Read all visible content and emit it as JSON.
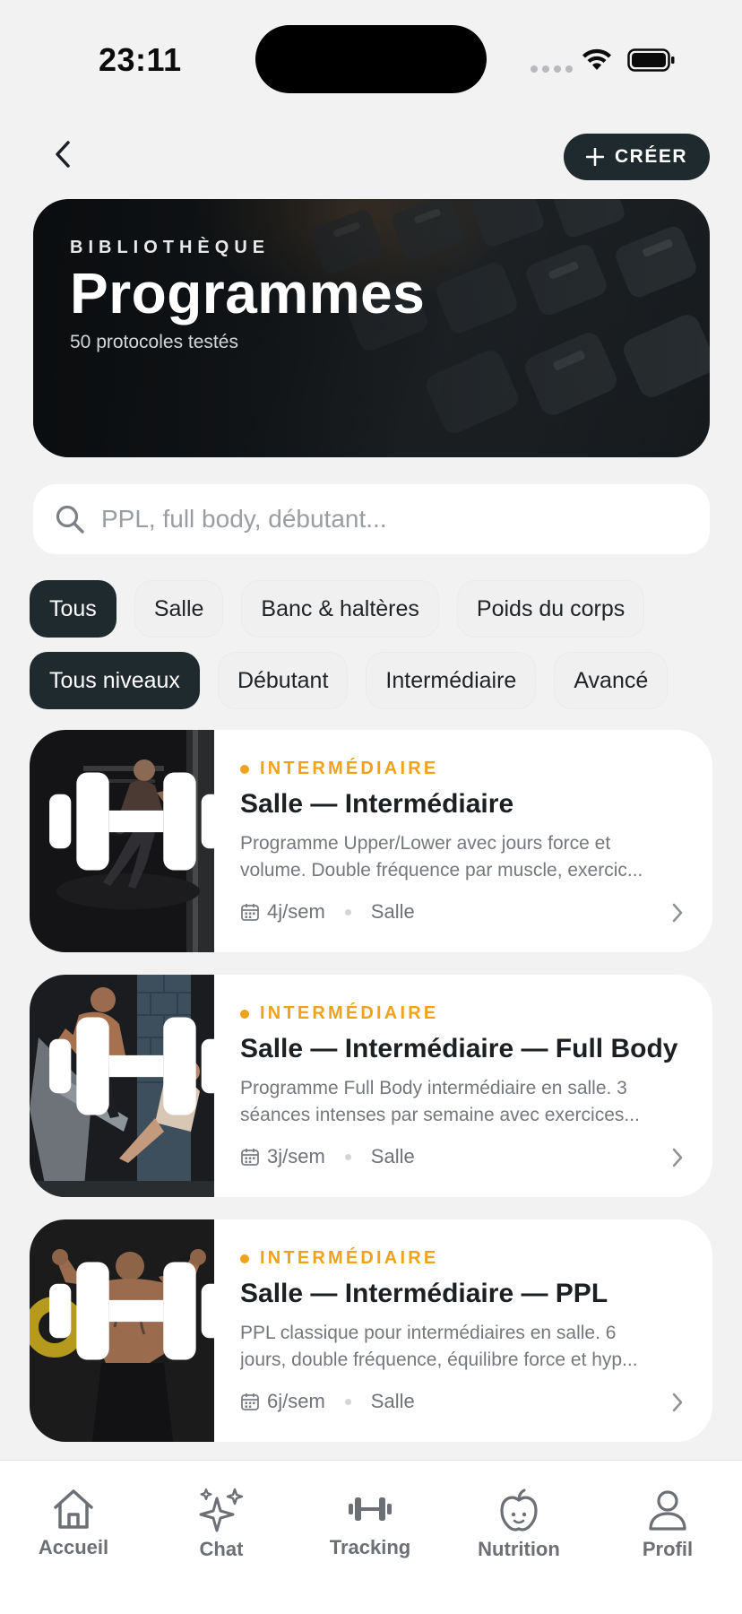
{
  "status_bar": {
    "time": "23:11"
  },
  "header": {
    "create_label": "CRÉER"
  },
  "hero": {
    "eyebrow": "BIBLIOTHÈQUE",
    "title": "Programmes",
    "subtitle": "50 protocoles testés"
  },
  "search": {
    "placeholder": "PPL, full body, débutant..."
  },
  "filters": {
    "equipment": [
      {
        "label": "Tous",
        "active": true
      },
      {
        "label": "Salle",
        "active": false
      },
      {
        "label": "Banc & haltères",
        "active": false
      },
      {
        "label": "Poids du corps",
        "active": false
      }
    ],
    "levels": [
      {
        "label": "Tous niveaux",
        "active": true
      },
      {
        "label": "Débutant",
        "active": false
      },
      {
        "label": "Intermédiaire",
        "active": false
      },
      {
        "label": "Avancé",
        "active": false
      }
    ]
  },
  "programs": [
    {
      "level": "INTERMÉDIAIRE",
      "title": "Salle — Intermédiaire",
      "desc_line1": "Programme Upper/Lower avec jours force et",
      "desc_line2": "volume. Double fréquence par muscle, exercic...",
      "frequency": "4j/sem",
      "location": "Salle"
    },
    {
      "level": "INTERMÉDIAIRE",
      "title": "Salle — Intermédiaire — Full Body",
      "desc_line1": "Programme Full Body intermédiaire en salle. 3",
      "desc_line2": "séances intenses par semaine avec exercices...",
      "frequency": "3j/sem",
      "location": "Salle"
    },
    {
      "level": "INTERMÉDIAIRE",
      "title": "Salle — Intermédiaire — PPL",
      "desc_line1": "PPL classique pour intermédiaires en salle. 6",
      "desc_line2": "jours, double fréquence, équilibre force et hyp...",
      "frequency": "6j/sem",
      "location": "Salle"
    }
  ],
  "tab_bar": {
    "items": [
      {
        "label": "Accueil",
        "icon": "home-icon"
      },
      {
        "label": "Chat",
        "icon": "sparkles-icon"
      },
      {
        "label": "Tracking",
        "icon": "dumbbell-icon"
      },
      {
        "label": "Nutrition",
        "icon": "apple-icon"
      },
      {
        "label": "Profil",
        "icon": "person-icon"
      }
    ]
  },
  "colors": {
    "accent_dark": "#1f2a2e",
    "level_orange": "#f0a21b",
    "background": "#f2f2f3"
  }
}
